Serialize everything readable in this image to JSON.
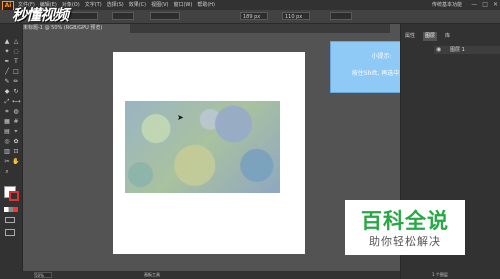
{
  "app": {
    "logo": "Ai",
    "menu": [
      "文件(F)",
      "编辑(E)",
      "对象(O)",
      "文字(T)",
      "选择(S)",
      "效果(C)",
      "视图(V)",
      "窗口(W)",
      "帮助(H)"
    ],
    "workspace": "传统基本功能",
    "window_controls": [
      "—",
      "□",
      "✕"
    ]
  },
  "watermark_top": "秒懂视频",
  "control_bar": {
    "field1": "189 px",
    "field2": "110 px"
  },
  "document_tab": "未标题-1 @ 50% (RGB/GPU 预览)",
  "tool_icons": [
    "selection-icon",
    "direct-selection-icon",
    "magic-wand-icon",
    "lasso-icon",
    "pen-icon",
    "type-icon",
    "line-icon",
    "rectangle-icon",
    "brush-icon",
    "pencil-icon",
    "eraser-icon",
    "rotate-icon",
    "scale-icon",
    "width-icon",
    "free-transform-icon",
    "shape-builder-icon",
    "perspective-icon",
    "mesh-icon",
    "gradient-icon",
    "eyedropper-icon",
    "blend-icon",
    "symbol-icon",
    "graph-icon",
    "artboard-icon",
    "slice-icon",
    "hand-icon",
    "zoom-icon"
  ],
  "tip": {
    "title": "小提示:",
    "text": "按住Shift, 再选中对象"
  },
  "right_panel": {
    "tabs": [
      "属性",
      "图层",
      "库"
    ],
    "layer_name": "图层 1"
  },
  "status": {
    "zoom": "50%",
    "tool": "画板工具",
    "foot": "1 个图层"
  },
  "watermark": {
    "big": "百科全说",
    "small": "助你轻松解决"
  },
  "colors": {
    "ui_dark": "#323232",
    "canvas": "#535353",
    "tip_bg": "#8fc9f6",
    "watermark_green": "#27a844"
  }
}
